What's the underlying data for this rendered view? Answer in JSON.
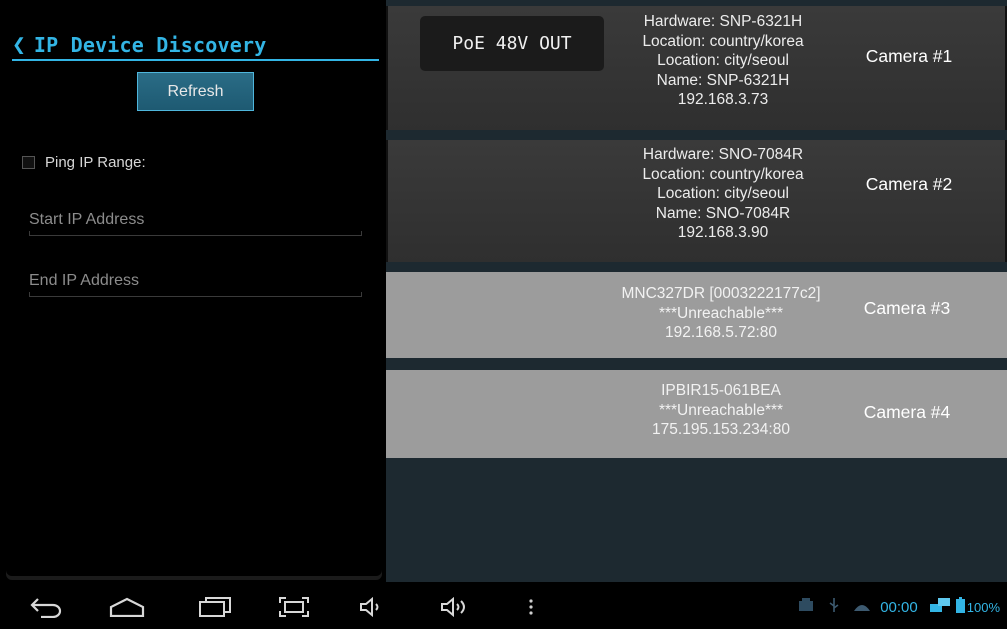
{
  "header": {
    "back_icon": "chevron-left-icon",
    "title": "IP Device Discovery"
  },
  "sidebar": {
    "refresh_label": "Refresh",
    "ping_label": "Ping IP Range:",
    "ping_checked": false,
    "start_ip": {
      "placeholder": "Start IP Address",
      "value": ""
    },
    "end_ip": {
      "placeholder": "End IP Address",
      "value": ""
    }
  },
  "devices": [
    {
      "lines": [
        "Hardware: SNP-6321H",
        "Location: country/korea",
        "Location: city/seoul",
        "Name: SNP-6321H",
        "192.168.3.73"
      ],
      "label": "Camera #1",
      "badge": "PoE 48V OUT"
    },
    {
      "lines": [
        "Hardware: SNO-7084R",
        "Location: country/korea",
        "Location: city/seoul",
        "Name: SNO-7084R",
        "192.168.3.90"
      ],
      "label": "Camera #2"
    },
    {
      "lines": [
        "MNC327DR [0003222177c2]",
        "***Unreachable***",
        "192.168.5.72:80"
      ],
      "label": "Camera #3"
    },
    {
      "lines": [
        "IPBIR15-061BEA",
        "***Unreachable***",
        "175.195.153.234:80"
      ],
      "label": "Camera #4"
    }
  ],
  "statusbar": {
    "time": "00:00",
    "battery": "100%",
    "accent": "#33b5e5"
  }
}
